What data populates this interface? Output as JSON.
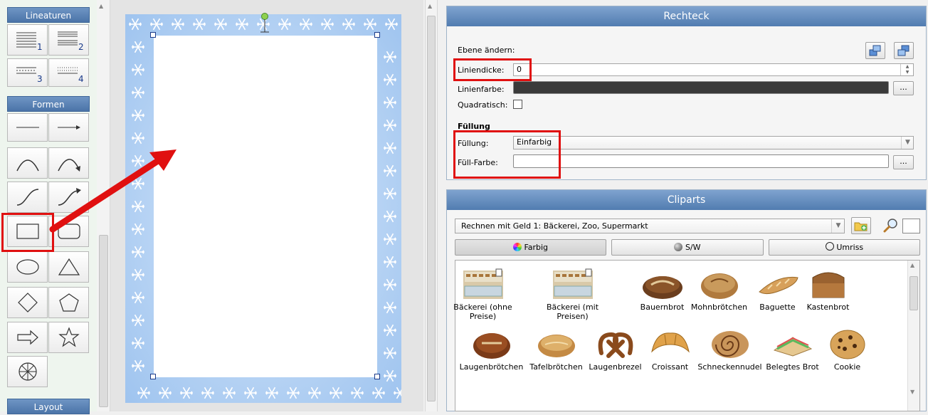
{
  "toolbox": {
    "section_lineaturen": "Lineaturen",
    "section_formen": "Formen",
    "section_layout": "Layout",
    "line_labels": [
      "1",
      "2",
      "3",
      "4"
    ]
  },
  "rechteck": {
    "title": "Rechteck",
    "ebene_label": "Ebene ändern:",
    "liniendicke_label": "Liniendicke:",
    "liniendicke_value": "0",
    "linienfarbe_label": "Linienfarbe:",
    "linienfarbe_color": "#3a3a3a",
    "quadratisch_label": "Quadratisch:",
    "fuellung_heading": "Füllung",
    "fuellung_label": "Füllung:",
    "fuellung_value": "Einfarbig",
    "fuellfarbe_label": "Füll-Farbe:",
    "browse_label": "..."
  },
  "cliparts": {
    "title": "Cliparts",
    "category": "Rechnen mit Geld 1: Bäckerei, Zoo, Supermarkt",
    "tabs": [
      "Farbig",
      "S/W",
      "Umriss"
    ],
    "row1": [
      "Bäckerei (ohne Preise)",
      "Bäckerei (mit Preisen)",
      "Bauernbrot",
      "Mohnbrötchen",
      "Baguette",
      "Kastenbrot"
    ],
    "row2": [
      "Laugenbrötchen",
      "Tafelbrötchen",
      "Laugenbrezel",
      "Croissant",
      "Schneckennudel",
      "Belegtes Brot",
      "Cookie"
    ]
  },
  "colors": {
    "accent_red": "#e01010",
    "header_blue": "#517cb0",
    "page_blue": "#bcd7f5"
  }
}
